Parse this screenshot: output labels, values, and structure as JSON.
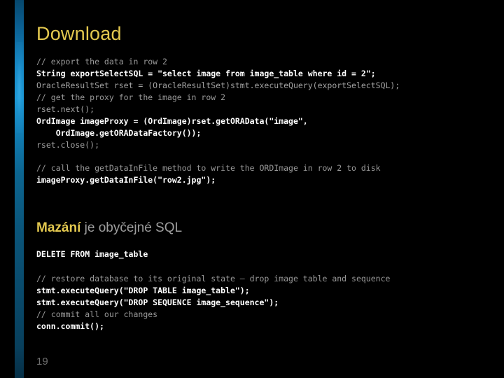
{
  "slide": {
    "title": "Download",
    "page_number": "19",
    "background_color": "#000000",
    "accent_color": "#1b9ad8",
    "title_color": "#e3c84f",
    "comment_color": "#9a9a9a",
    "code_color": "#ffffff"
  },
  "code_block_1": {
    "lines": [
      {
        "text": "// export the data in row 2",
        "style": "comment"
      },
      {
        "text": "String exportSelectSQL = \"select image from image_table where id = 2\";",
        "style": "strong"
      },
      {
        "text": "OracleResultSet rset = (OracleResultSet)stmt.executeQuery(exportSelectSQL);",
        "style": "dim"
      },
      {
        "text": "// get the proxy for the image in row 2",
        "style": "comment"
      },
      {
        "text": "rset.next();",
        "style": "dim"
      },
      {
        "text": "OrdImage imageProxy = (OrdImage)rset.getORAData(\"image\",",
        "style": "strong"
      },
      {
        "text": "    OrdImage.getORADataFactory());",
        "style": "strong"
      },
      {
        "text": "rset.close();",
        "style": "dim"
      }
    ]
  },
  "code_block_2": {
    "lines": [
      {
        "text": "// call the getDataInFile method to write the ORDImage in row 2 to disk",
        "style": "comment"
      },
      {
        "text": "imageProxy.getDataInFile(\"row2.jpg\");",
        "style": "strong"
      }
    ]
  },
  "section_heading": {
    "highlight": "Mazání",
    "rest": " je obyčejné SQL"
  },
  "sql_statement": {
    "text": "DELETE FROM image_table"
  },
  "code_block_4": {
    "lines": [
      {
        "text": "// restore database to its original state – drop image table and sequence",
        "style": "comment"
      },
      {
        "text": "stmt.executeQuery(\"DROP TABLE image_table\");",
        "style": "strong"
      },
      {
        "text": "stmt.executeQuery(\"DROP SEQUENCE image_sequence\");",
        "style": "strong"
      },
      {
        "text": "// commit all our changes",
        "style": "comment"
      },
      {
        "text": "conn.commit();",
        "style": "strong"
      }
    ]
  }
}
